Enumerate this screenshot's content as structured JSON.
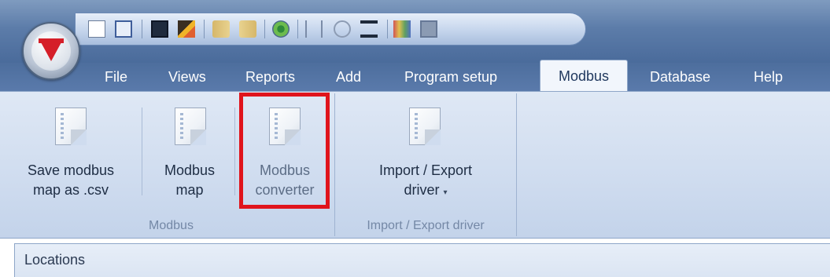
{
  "window": {
    "qat_icons": [
      "new-document-icon",
      "print-icon",
      "save-icon",
      "edit-icon",
      "forward-icon",
      "back-icon",
      "settings-gear-icon",
      "antenna-icon",
      "wireless-icon",
      "network-icon",
      "color-palette-icon",
      "monitor-icon"
    ]
  },
  "menu": {
    "tabs": [
      {
        "label": "File"
      },
      {
        "label": "Views"
      },
      {
        "label": "Reports"
      },
      {
        "label": "Add"
      },
      {
        "label": "Program setup"
      },
      {
        "label": "Modbus"
      },
      {
        "label": "Database"
      },
      {
        "label": "Help"
      }
    ],
    "active_tab": "Modbus"
  },
  "ribbon": {
    "groups": [
      {
        "label": "Modbus",
        "buttons": [
          {
            "line1": "Save modbus",
            "line2": "map as .csv"
          },
          {
            "line1": "Modbus",
            "line2": "map"
          },
          {
            "line1": "Modbus",
            "line2": "converter"
          }
        ]
      },
      {
        "label": "Import / Export driver",
        "buttons": [
          {
            "line1": "Import / Export",
            "line2": "driver"
          }
        ]
      }
    ]
  },
  "panel": {
    "title": "Locations"
  },
  "colors": {
    "highlight": "#e0141c",
    "brand_red": "#d51f29"
  }
}
